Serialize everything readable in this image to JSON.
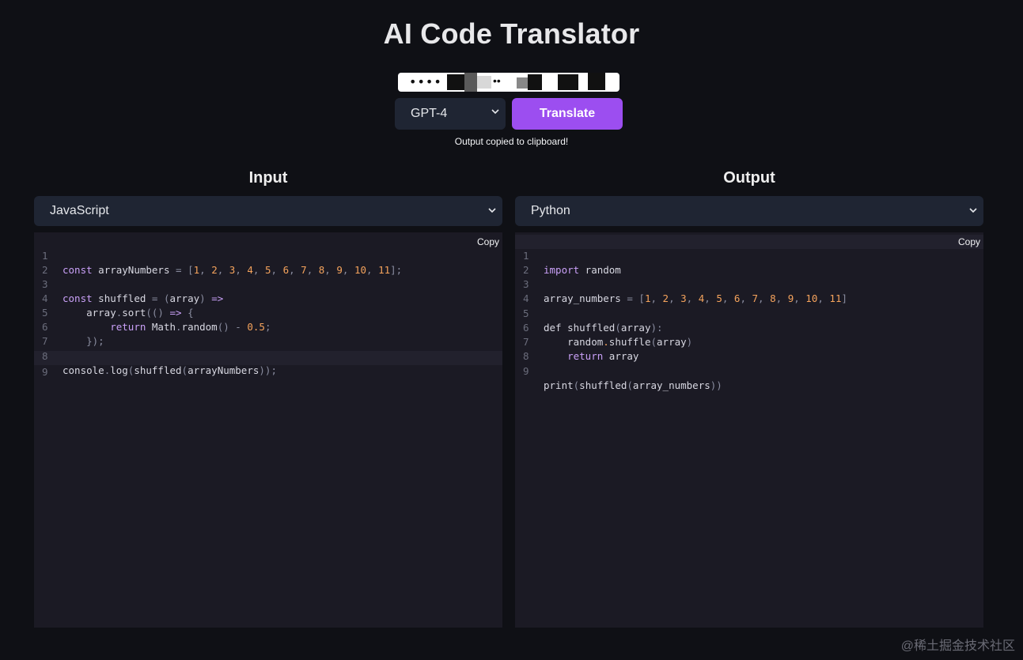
{
  "header": {
    "title": "AI Code Translator"
  },
  "api_key": {
    "masked_value": "••••",
    "masked_value_tail": "••"
  },
  "model": {
    "selected": "GPT-4"
  },
  "translate_button": {
    "label": "Translate"
  },
  "status": {
    "message": "Output copied to clipboard!"
  },
  "input_panel": {
    "heading": "Input",
    "language": "JavaScript",
    "copy_label": "Copy",
    "line_numbers": [
      "1",
      "2",
      "3",
      "4",
      "5",
      "6",
      "7",
      "8",
      "9"
    ]
  },
  "output_panel": {
    "heading": "Output",
    "language": "Python",
    "copy_label": "Copy",
    "line_numbers": [
      "1",
      "2",
      "3",
      "4",
      "5",
      "6",
      "7",
      "8",
      "9"
    ]
  },
  "watermark": "@稀土掘金技术社区",
  "colors": {
    "background": "#0f1015",
    "accent": "#9c4ef0",
    "panel": "#1b1a24",
    "select": "#1f2533",
    "keyword": "#c9a0f7",
    "number": "#f5a35c"
  },
  "icons": {
    "select_chevron": "chevron-down-icon"
  }
}
